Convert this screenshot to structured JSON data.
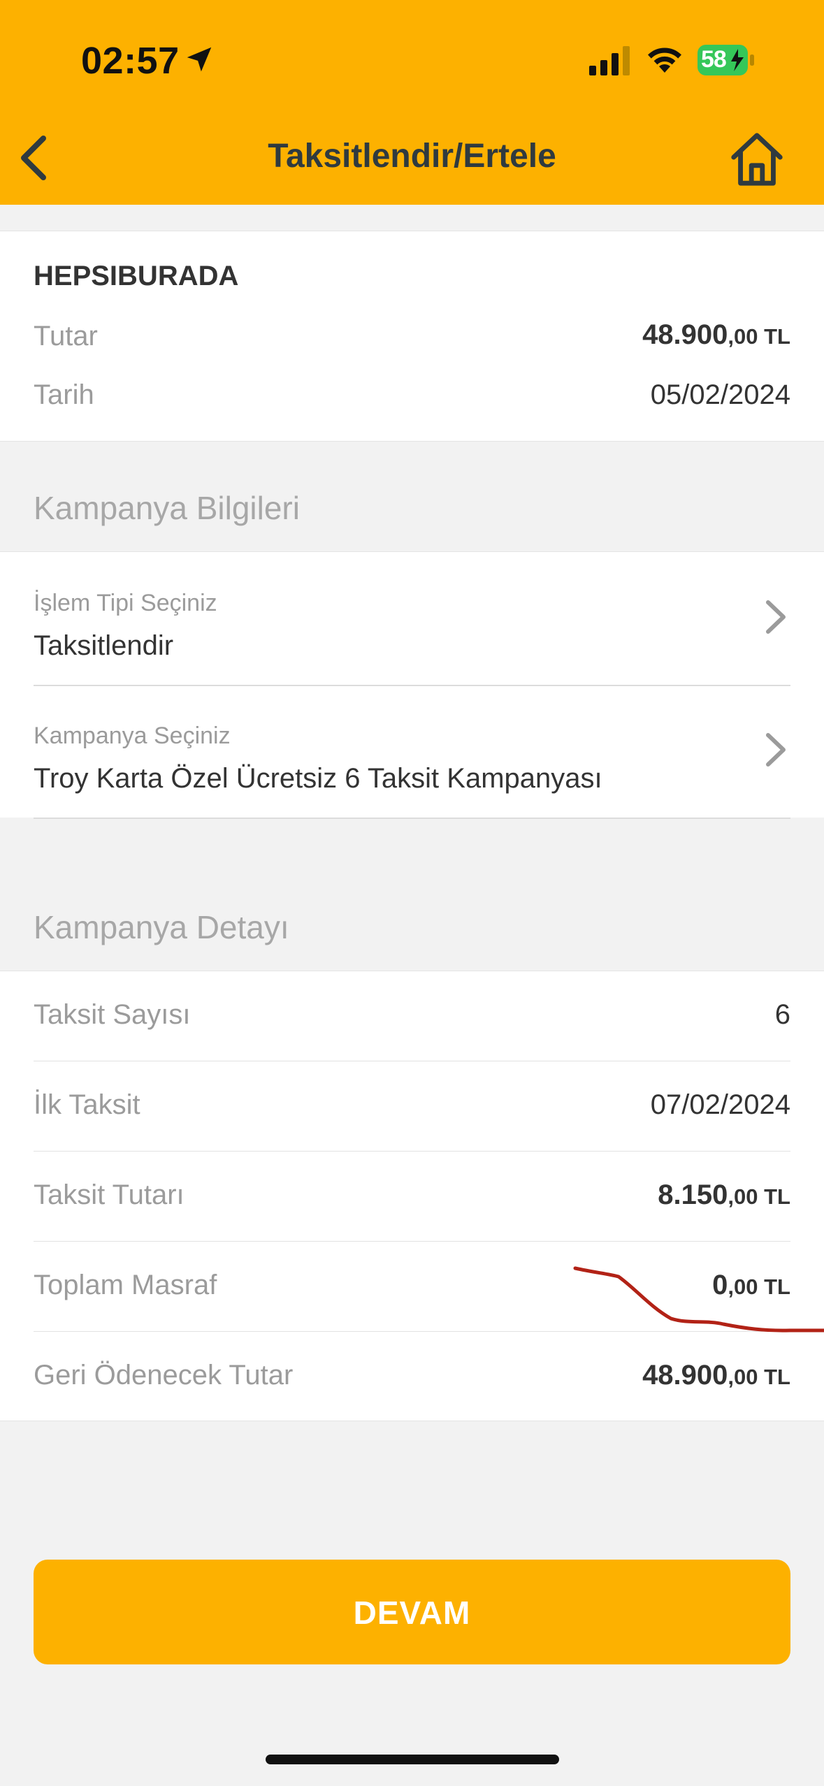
{
  "status_bar": {
    "time": "02:57",
    "battery": "58"
  },
  "nav": {
    "title": "Taksitlendir/Ertele"
  },
  "transaction": {
    "merchant": "HEPSIBURADA",
    "amount_label": "Tutar",
    "amount_main": "48.900",
    "amount_cents": ",00 TL",
    "date_label": "Tarih",
    "date_value": "05/02/2024"
  },
  "campaign_info": {
    "section_title": "Kampanya Bilgileri",
    "operation_type_label": "İşlem Tipi Seçiniz",
    "operation_type_value": "Taksitlendir",
    "campaign_label": "Kampanya Seçiniz",
    "campaign_value": "Troy Karta Özel Ücretsiz 6 Taksit Kampanyası"
  },
  "campaign_detail": {
    "section_title": "Kampanya Detayı",
    "rows": [
      {
        "label": "Taksit Sayısı",
        "value": "6"
      },
      {
        "label": "İlk Taksit",
        "value": "07/02/2024"
      },
      {
        "label": "Taksit Tutarı",
        "main": "8.150",
        "cents": ",00 TL"
      },
      {
        "label": "Toplam Masraf",
        "main": "0",
        "cents": ",00 TL"
      },
      {
        "label": "Geri Ödenecek Tutar",
        "main": "48.900",
        "cents": ",00 TL"
      }
    ]
  },
  "actions": {
    "continue_label": "DEVAM"
  },
  "colors": {
    "brand": "#fdb100",
    "scribble": "#b22216"
  }
}
